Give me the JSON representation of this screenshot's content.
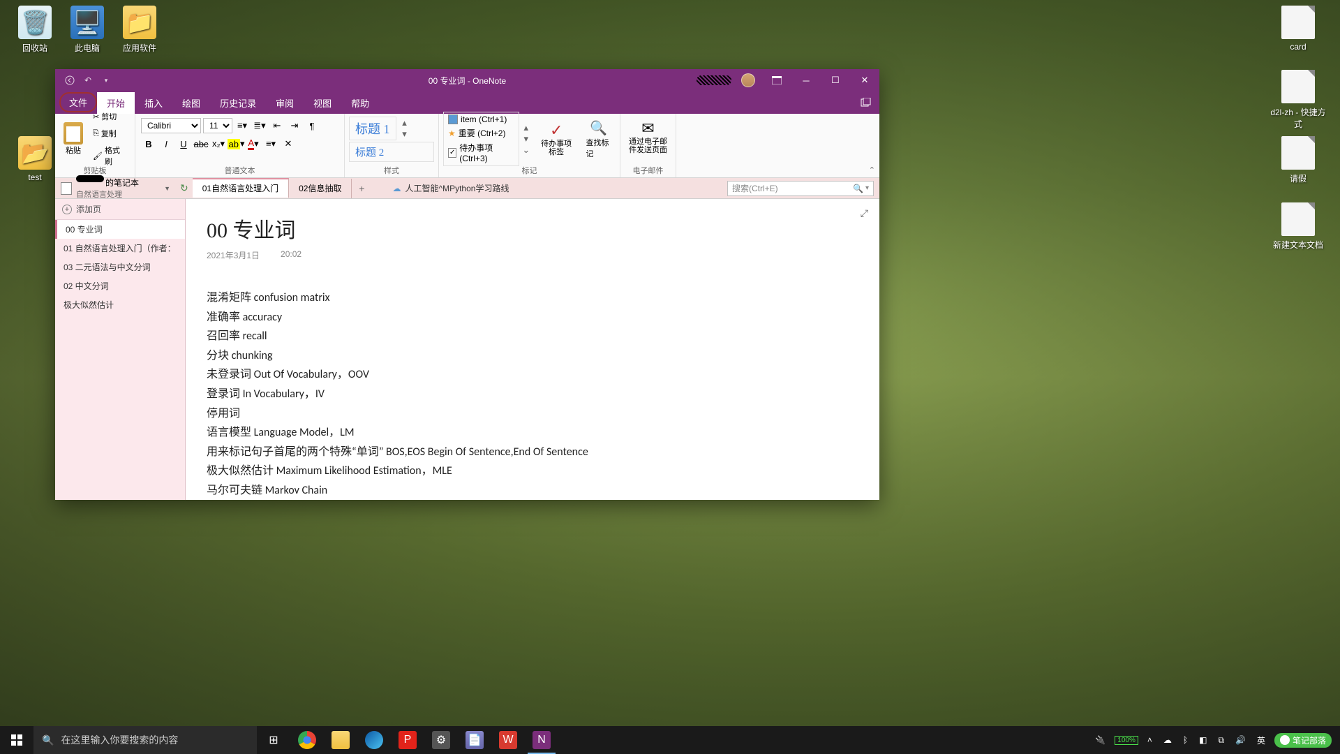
{
  "desktop_icons": {
    "recycle": "回收站",
    "pc": "此电脑",
    "apps": "应用软件",
    "test": "test",
    "card": "card",
    "d2l": "d2l-zh - 快捷方式",
    "leave": "请假",
    "newtxt": "新建文本文档"
  },
  "titlebar": {
    "title": "00  专业词  -  OneNote"
  },
  "ribbon_tabs": {
    "file": "文件",
    "home": "开始",
    "insert": "插入",
    "draw": "绘图",
    "history": "历史记录",
    "review": "审阅",
    "view": "视图",
    "help": "帮助"
  },
  "ribbon": {
    "paste": "粘贴",
    "cut": "剪切",
    "copy": "复制",
    "format_painter": "格式刷",
    "clipboard_label": "剪贴板",
    "font_name": "Calibri",
    "font_size": "11",
    "text_label": "普通文本",
    "style1": "标题 1",
    "style2": "标题 2",
    "styles_label": "样式",
    "tag1": "item (Ctrl+1)",
    "tag2": "重要 (Ctrl+2)",
    "tag3": "待办事项 (Ctrl+3)",
    "todo": "待办事项标签",
    "findtags": "查找标记",
    "tags_label": "标记",
    "email": "通过电子邮件发送页面",
    "email_label": "电子邮件"
  },
  "notebook": {
    "name_suffix": "的笔记本",
    "section_label": "自然语言处理",
    "tab1": "01自然语言处理入门",
    "tab2": "02信息抽取",
    "related": "人工智能^MPython学习路线",
    "search_placeholder": "搜索(Ctrl+E)"
  },
  "pages": {
    "add": "添加页",
    "p0": "00  专业词",
    "p1": "01 自然语言处理入门（作者：",
    "p2": "03 二元语法与中文分词",
    "p3": "02 中文分词",
    "p4": "极大似然估计"
  },
  "page": {
    "title": "00  专业词",
    "date": "2021年3月1日",
    "time": "20:02",
    "lines": [
      "混淆矩阵    confusion matrix",
      "准确率    accuracy",
      "召回率   recall",
      "分块   chunking",
      "未登录词   Out Of Vocabulary，OOV",
      "登录词   In Vocabulary，IV",
      "停用词",
      "语言模型  Language Model，LM",
      "用来标记句子首尾的两个特殊“单词”     BOS,EOS        Begin Of Sentence,End Of Sentence",
      "极大似然估计   Maximum Likelihood Estimation，MLE",
      "马尔可夫链   Markov Chain"
    ]
  },
  "taskbar": {
    "search_placeholder": "在这里输入你要搜索的内容",
    "battery": "100%",
    "note_app": "笔记部落"
  }
}
